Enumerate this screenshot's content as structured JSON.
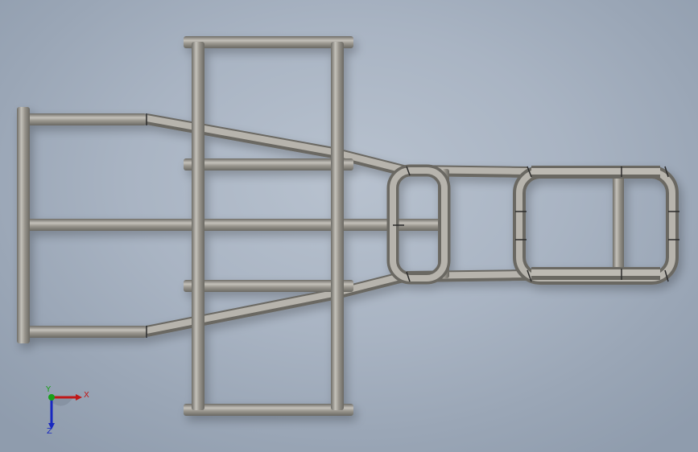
{
  "viewport": {
    "tube_color": "#8f8c85",
    "tube_highlight": "#bfbcb5",
    "tube_shadow": "#6a6862"
  },
  "triad": {
    "x_label": "X",
    "y_label": "Y",
    "z_label": "Z",
    "x_color": "#c01818",
    "y_color": "#18a018",
    "z_color": "#1828c0"
  }
}
